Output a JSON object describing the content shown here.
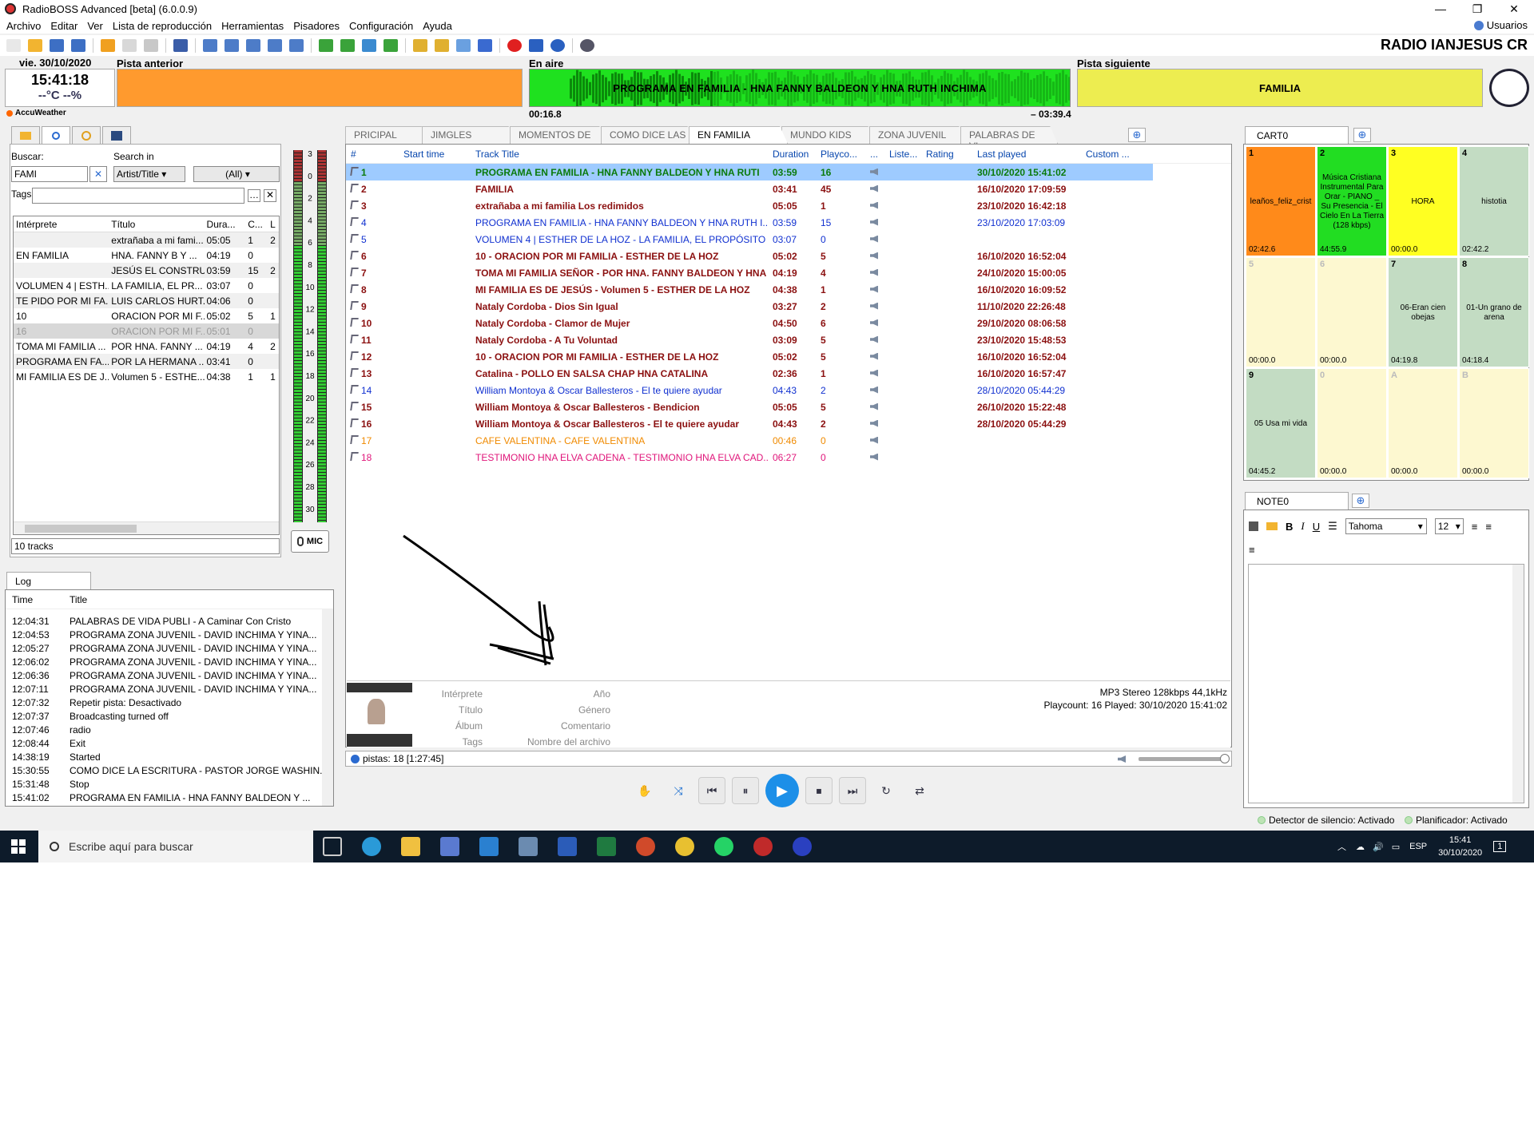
{
  "window": {
    "title": "RadioBOSS Advanced [beta] (6.0.0.9)"
  },
  "menu": [
    "Archivo",
    "Editar",
    "Ver",
    "Lista de reproducción",
    "Herramientas",
    "Pisadores",
    "Configuración",
    "Ayuda"
  ],
  "users_label": "Usuarios",
  "station_name": "RADIO IANJESUS CR",
  "clock": {
    "date": "vie. 30/10/2020",
    "time": "15:41:18",
    "temp": "--°C --%",
    "weather_label": "AccuWeather"
  },
  "player": {
    "prev_label": "Pista anterior",
    "onair_label": "En aire",
    "next_label": "Pista siguiente",
    "onair_title": "PROGRAMA EN FAMILIA - HNA FANNY BALDEON Y HNA RUTH INCHIMA",
    "next_title": "FAMILIA",
    "elapsed": "00:16.8",
    "remaining": "– 03:39.4"
  },
  "search": {
    "buscar_label": "Buscar:",
    "search_in_label": "Search in",
    "query": "FAMI",
    "search_in": "Artist/Title",
    "filter": "(All)",
    "tags_label": "Tags",
    "columns": [
      "Intérprete",
      "Título",
      "Dura...",
      "C...",
      "L"
    ],
    "rows": [
      {
        "artist": "",
        "title": "extrañaba a mi fami...",
        "dur": "05:05",
        "c": "1",
        "l": "2"
      },
      {
        "artist": "EN FAMILIA",
        "title": "HNA. FANNY B  Y ...",
        "dur": "04:19",
        "c": "0",
        "l": ""
      },
      {
        "artist": "",
        "title": "JESÚS EL CONSTRU...",
        "dur": "03:59",
        "c": "15",
        "l": "2"
      },
      {
        "artist": "VOLUMEN 4 | ESTH...",
        "title": "LA FAMILIA, EL PR...",
        "dur": "03:07",
        "c": "0",
        "l": ""
      },
      {
        "artist": "TE PIDO POR MI FA...",
        "title": "LUIS CARLOS HURT...",
        "dur": "04:06",
        "c": "0",
        "l": ""
      },
      {
        "artist": "10",
        "title": "ORACION POR MI F...",
        "dur": "05:02",
        "c": "5",
        "l": "1"
      },
      {
        "artist": "16",
        "title": "ORACION POR MI F...",
        "dur": "05:01",
        "c": "0",
        "l": ""
      },
      {
        "artist": "TOMA MI FAMILIA ...",
        "title": "POR HNA. FANNY ...",
        "dur": "04:19",
        "c": "4",
        "l": "2"
      },
      {
        "artist": "PROGRAMA EN FA...",
        "title": "POR LA HERMANA ...",
        "dur": "03:41",
        "c": "0",
        "l": ""
      },
      {
        "artist": "MI FAMILIA ES DE J...",
        "title": "Volumen 5 - ESTHE...",
        "dur": "04:38",
        "c": "1",
        "l": "1"
      }
    ],
    "count": "10 tracks"
  },
  "meter": {
    "scale": [
      "3",
      "0",
      "2",
      "4",
      "6",
      "8",
      "10",
      "12",
      "14",
      "16",
      "18",
      "20",
      "22",
      "24",
      "26",
      "28",
      "30"
    ],
    "mic_label": "MIC"
  },
  "log": {
    "tab": "Log",
    "columns": [
      "Time",
      "Title"
    ],
    "rows": [
      {
        "t": "12:04:31",
        "x": "PALABRAS DE VIDA PUBLI - A Caminar Con Cristo"
      },
      {
        "t": "12:04:53",
        "x": "PROGRAMA ZONA JUVENIL - DAVID INCHIMA Y YINA..."
      },
      {
        "t": "12:05:27",
        "x": "PROGRAMA ZONA JUVENIL - DAVID INCHIMA Y YINA..."
      },
      {
        "t": "12:06:02",
        "x": "PROGRAMA ZONA JUVENIL - DAVID INCHIMA Y YINA..."
      },
      {
        "t": "12:06:36",
        "x": "PROGRAMA ZONA JUVENIL - DAVID INCHIMA Y YINA..."
      },
      {
        "t": "12:07:11",
        "x": "PROGRAMA ZONA JUVENIL - DAVID INCHIMA Y YINA..."
      },
      {
        "t": "12:07:32",
        "x": "Repetir pista: Desactivado"
      },
      {
        "t": "12:07:37",
        "x": "Broadcasting turned off"
      },
      {
        "t": "12:07:46",
        "x": "radio"
      },
      {
        "t": "12:08:44",
        "x": "Exit"
      },
      {
        "t": "14:38:19",
        "x": "Started"
      },
      {
        "t": "15:30:55",
        "x": "COMO DICE LA ESCRITURA - PASTOR JORGE WASHIN..."
      },
      {
        "t": "15:31:48",
        "x": "Stop"
      },
      {
        "t": "15:41:02",
        "x": "PROGRAMA EN FAMILIA - HNA FANNY BALDEON Y ..."
      }
    ]
  },
  "playlist_tabs": [
    "PRICIPAL",
    "JIMGLES",
    "MOMENTOS DE ...",
    "COMO DICE LAS ...",
    "EN FAMILIA",
    "MUNDO KIDS",
    "ZONA JUVENIL",
    "PALABRAS DE VI..."
  ],
  "playlist_active_tab": "EN FAMILIA",
  "playlist": {
    "columns": [
      "#",
      "Start time",
      "Track Title",
      "Duration",
      "Playco...",
      "...",
      "Liste...",
      "Rating",
      "Last played",
      "Custom ..."
    ],
    "rows": [
      {
        "n": "1",
        "title": "PROGRAMA EN FAMILIA - HNA FANNY BALDEON Y HNA RUTI",
        "dur": "03:59",
        "pc": "16",
        "last": "30/10/2020 15:41:02",
        "color": "#0a7a0a",
        "bold": true
      },
      {
        "n": "2",
        "title": "FAMILIA",
        "dur": "03:41",
        "pc": "45",
        "last": "16/10/2020 17:09:59",
        "color": "#8b1010",
        "bold": true
      },
      {
        "n": "3",
        "title": "extrañaba a mi familia Los redimidos",
        "dur": "05:05",
        "pc": "1",
        "last": "23/10/2020 16:42:18",
        "color": "#8b1010",
        "bold": true
      },
      {
        "n": "4",
        "title": "PROGRAMA EN FAMILIA - HNA FANNY BALDEON Y HNA RUTH I...",
        "dur": "03:59",
        "pc": "15",
        "last": "23/10/2020 17:03:09",
        "color": "#1030d0",
        "bold": false
      },
      {
        "n": "5",
        "title": "VOLUMEN 4 | ESTHER DE LA HOZ - LA FAMILIA, EL PROPÓSITO D...",
        "dur": "03:07",
        "pc": "0",
        "last": "",
        "color": "#1030d0",
        "bold": false
      },
      {
        "n": "6",
        "title": "10 - ORACION POR MI FAMILIA - ESTHER DE LA HOZ",
        "dur": "05:02",
        "pc": "5",
        "last": "16/10/2020 16:52:04",
        "color": "#8b1010",
        "bold": true
      },
      {
        "n": "7",
        "title": "TOMA MI FAMILIA SEÑOR - POR HNA. FANNY BALDEON Y  HNA ...",
        "dur": "04:19",
        "pc": "4",
        "last": "24/10/2020 15:00:05",
        "color": "#8b1010",
        "bold": true
      },
      {
        "n": "8",
        "title": "MI FAMILIA ES DE JESÚS - Volumen 5 - ESTHER DE LA HOZ",
        "dur": "04:38",
        "pc": "1",
        "last": "16/10/2020 16:09:52",
        "color": "#8b1010",
        "bold": true
      },
      {
        "n": "9",
        "title": "Nataly Cordoba - Dios Sin Igual",
        "dur": "03:27",
        "pc": "2",
        "last": "11/10/2020 22:26:48",
        "color": "#8b1010",
        "bold": true
      },
      {
        "n": "10",
        "title": "Nataly Cordoba - Clamor de Mujer",
        "dur": "04:50",
        "pc": "6",
        "last": "29/10/2020 08:06:58",
        "color": "#8b1010",
        "bold": true
      },
      {
        "n": "11",
        "title": "Nataly Cordoba - A Tu Voluntad",
        "dur": "03:09",
        "pc": "5",
        "last": "23/10/2020 15:48:53",
        "color": "#8b1010",
        "bold": true
      },
      {
        "n": "12",
        "title": "10 - ORACION POR MI FAMILIA - ESTHER DE LA HOZ",
        "dur": "05:02",
        "pc": "5",
        "last": "16/10/2020 16:52:04",
        "color": "#8b1010",
        "bold": true
      },
      {
        "n": "13",
        "title": "Catalina - POLLO EN SALSA CHAP HNA CATALINA",
        "dur": "02:36",
        "pc": "1",
        "last": "16/10/2020 16:57:47",
        "color": "#8b1010",
        "bold": true
      },
      {
        "n": "14",
        "title": "William Montoya & Oscar Ballesteros - El te quiere ayudar",
        "dur": "04:43",
        "pc": "2",
        "last": "28/10/2020 05:44:29",
        "color": "#1030d0",
        "bold": false
      },
      {
        "n": "15",
        "title": "William Montoya & Oscar Ballesteros - Bendicion",
        "dur": "05:05",
        "pc": "5",
        "last": "26/10/2020 15:22:48",
        "color": "#8b1010",
        "bold": true
      },
      {
        "n": "16",
        "title": "William Montoya & Oscar Ballesteros - El te quiere ayudar",
        "dur": "04:43",
        "pc": "2",
        "last": "28/10/2020 05:44:29",
        "color": "#8b1010",
        "bold": true
      },
      {
        "n": "17",
        "title": "CAFE VALENTINA - CAFE VALENTINA",
        "dur": "00:46",
        "pc": "0",
        "last": "",
        "color": "#f08a00",
        "bold": false
      },
      {
        "n": "18",
        "title": "TESTIMONIO HNA ELVA CADENA - TESTIMONIO HNA ELVA CAD...",
        "dur": "06:27",
        "pc": "0",
        "last": "",
        "color": "#e0157a",
        "bold": false
      }
    ]
  },
  "trackinfo": {
    "labels": [
      "Intérprete",
      "Título",
      "Álbum",
      "Tags"
    ],
    "labels2": [
      "Año",
      "Género",
      "Comentario",
      "Nombre del archivo"
    ],
    "format": "MP3 Stereo 128kbps 44,1kHz",
    "playcount": "Playcount: 16  Played: 30/10/2020 15:41:02"
  },
  "status": {
    "pistas": "pistas: 18 [1:27:45]"
  },
  "cart": {
    "tab": "CART0",
    "cells": [
      {
        "n": "1",
        "label": "leaños_feliz_crist",
        "time": "02:42.6",
        "color": "#ff8a1a"
      },
      {
        "n": "2",
        "label": "Música Cristiana Instrumental Para Orar - PIANO _ Su Presencia - El Cielo En La Tierra (128 kbps)",
        "time": "44:55.9",
        "color": "#22dd22"
      },
      {
        "n": "3",
        "label": "HORA",
        "time": "00:00.0",
        "color": "#ffff22"
      },
      {
        "n": "4",
        "label": "histotia",
        "time": "02:42.2",
        "color": "#c3dcc3"
      },
      {
        "n": "5",
        "label": "",
        "time": "00:00.0",
        "color": "#fdf8d0"
      },
      {
        "n": "6",
        "label": "",
        "time": "00:00.0",
        "color": "#fdf8d0"
      },
      {
        "n": "7",
        "label": "06-Eran cien obejas",
        "time": "04:19.8",
        "color": "#c3dcc3"
      },
      {
        "n": "8",
        "label": "01-Un grano de arena",
        "time": "04:18.4",
        "color": "#c3dcc3"
      },
      {
        "n": "9",
        "label": "05 Usa mi vida",
        "time": "04:45.2",
        "color": "#c3dcc3"
      },
      {
        "n": "0",
        "label": "",
        "time": "00:00.0",
        "color": "#fdf8d0"
      },
      {
        "n": "A",
        "label": "",
        "time": "00:00.0",
        "color": "#fdf8d0"
      },
      {
        "n": "B",
        "label": "",
        "time": "00:00.0",
        "color": "#fdf8d0"
      }
    ]
  },
  "note": {
    "tab": "NOTE0",
    "font": "Tahoma",
    "size": "12"
  },
  "bottom_status": {
    "silence": "Detector de silencio: Activado",
    "scheduler": "Planificador: Activado"
  },
  "taskbar": {
    "search_placeholder": "Escribe aquí para buscar",
    "lang": "ESP",
    "time": "15:41",
    "date": "30/10/2020",
    "notif": "1"
  }
}
